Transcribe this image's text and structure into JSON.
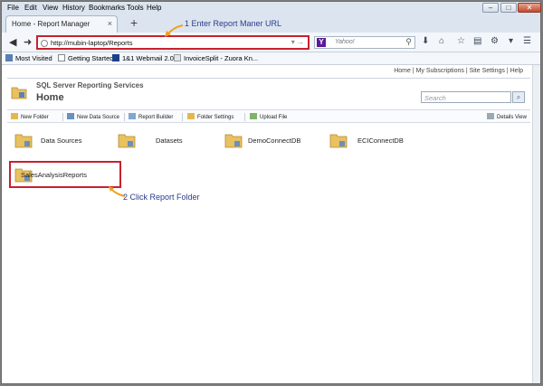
{
  "menubar": {
    "items": [
      "File",
      "Edit",
      "View",
      "History",
      "Bookmarks",
      "Tools",
      "Help"
    ],
    "window_controls": [
      "–",
      "□",
      "✕"
    ]
  },
  "tab": {
    "title": "Home - Report Manager",
    "close": "×",
    "new_tab": "+"
  },
  "nav": {
    "url": "http://mubin-laptop/Reports",
    "search_placeholder": "Yahoo!",
    "yahoo_letter": "Y"
  },
  "bookmarks": [
    "Most Visited",
    "Getting Started",
    "1&1 Webmail 2.0",
    "InvoiceSplit - Zuora Kn..."
  ],
  "rs": {
    "top_links": "Home | My Subscriptions | Site Settings | Help",
    "product_title": "SQL Server Reporting Services",
    "page_title": "Home",
    "search_placeholder": "Search",
    "search_btn": "⌕"
  },
  "toolbar": {
    "new_folder": "New Folder",
    "new_data_source": "New Data Source",
    "report_builder": "Report Builder",
    "folder_settings": "Folder Settings",
    "upload_file": "Upload File",
    "details_view": "Details View"
  },
  "folders": [
    "Data Sources",
    "Datasets",
    "DemoConnectDB",
    "ECIConnectDB",
    "SalesAnalysisReports"
  ],
  "callouts": {
    "step1": "1 Enter Report Maner URL",
    "step2": "2 Click Report Folder"
  },
  "colors": {
    "highlight": "#c8202f",
    "callout_text": "#2a3a8e",
    "arrow": "#f0a020"
  }
}
